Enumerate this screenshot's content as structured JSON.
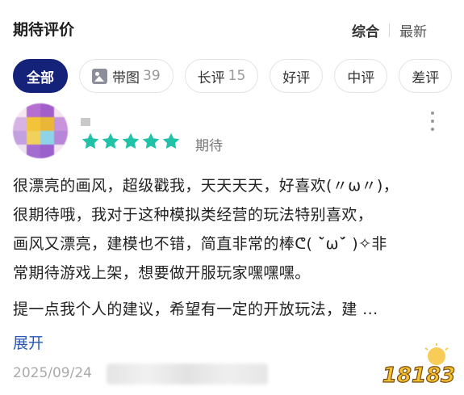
{
  "header": {
    "title": "期待评价",
    "sort_options": [
      "综合",
      "最新"
    ]
  },
  "filters": [
    {
      "label": "全部",
      "count": "",
      "selected": true
    },
    {
      "label": "带图",
      "count": "39",
      "icon": "image-icon"
    },
    {
      "label": "长评",
      "count": "15"
    },
    {
      "label": "好评",
      "count": ""
    },
    {
      "label": "中评",
      "count": ""
    },
    {
      "label": "差评",
      "count": ""
    }
  ],
  "review": {
    "stars": 5,
    "star_color": "#20c3a8",
    "rating_label": "期待",
    "lines": [
      "很漂亮的画风，超级戳我，天天天天，好喜欢(〃ω〃)，",
      "很期待哦，我对于这种模拟类经营的玩法特别喜欢，",
      "画风又漂亮，建模也不错，简直非常的棒ᕦ( ˘̀ω˘́ )✧非",
      "常期待游戏上架，想要做开服玩家嘿嘿嘿。"
    ],
    "suggestion": "提一点我个人的建议，希望有一定的开放玩法，建 ...",
    "expand_label": "展开",
    "date": "2025/09/24"
  },
  "watermark": {
    "text": "18183"
  },
  "colors": {
    "accent_dark": "#15227a",
    "link": "#2a56b5",
    "star": "#20c3a8"
  }
}
